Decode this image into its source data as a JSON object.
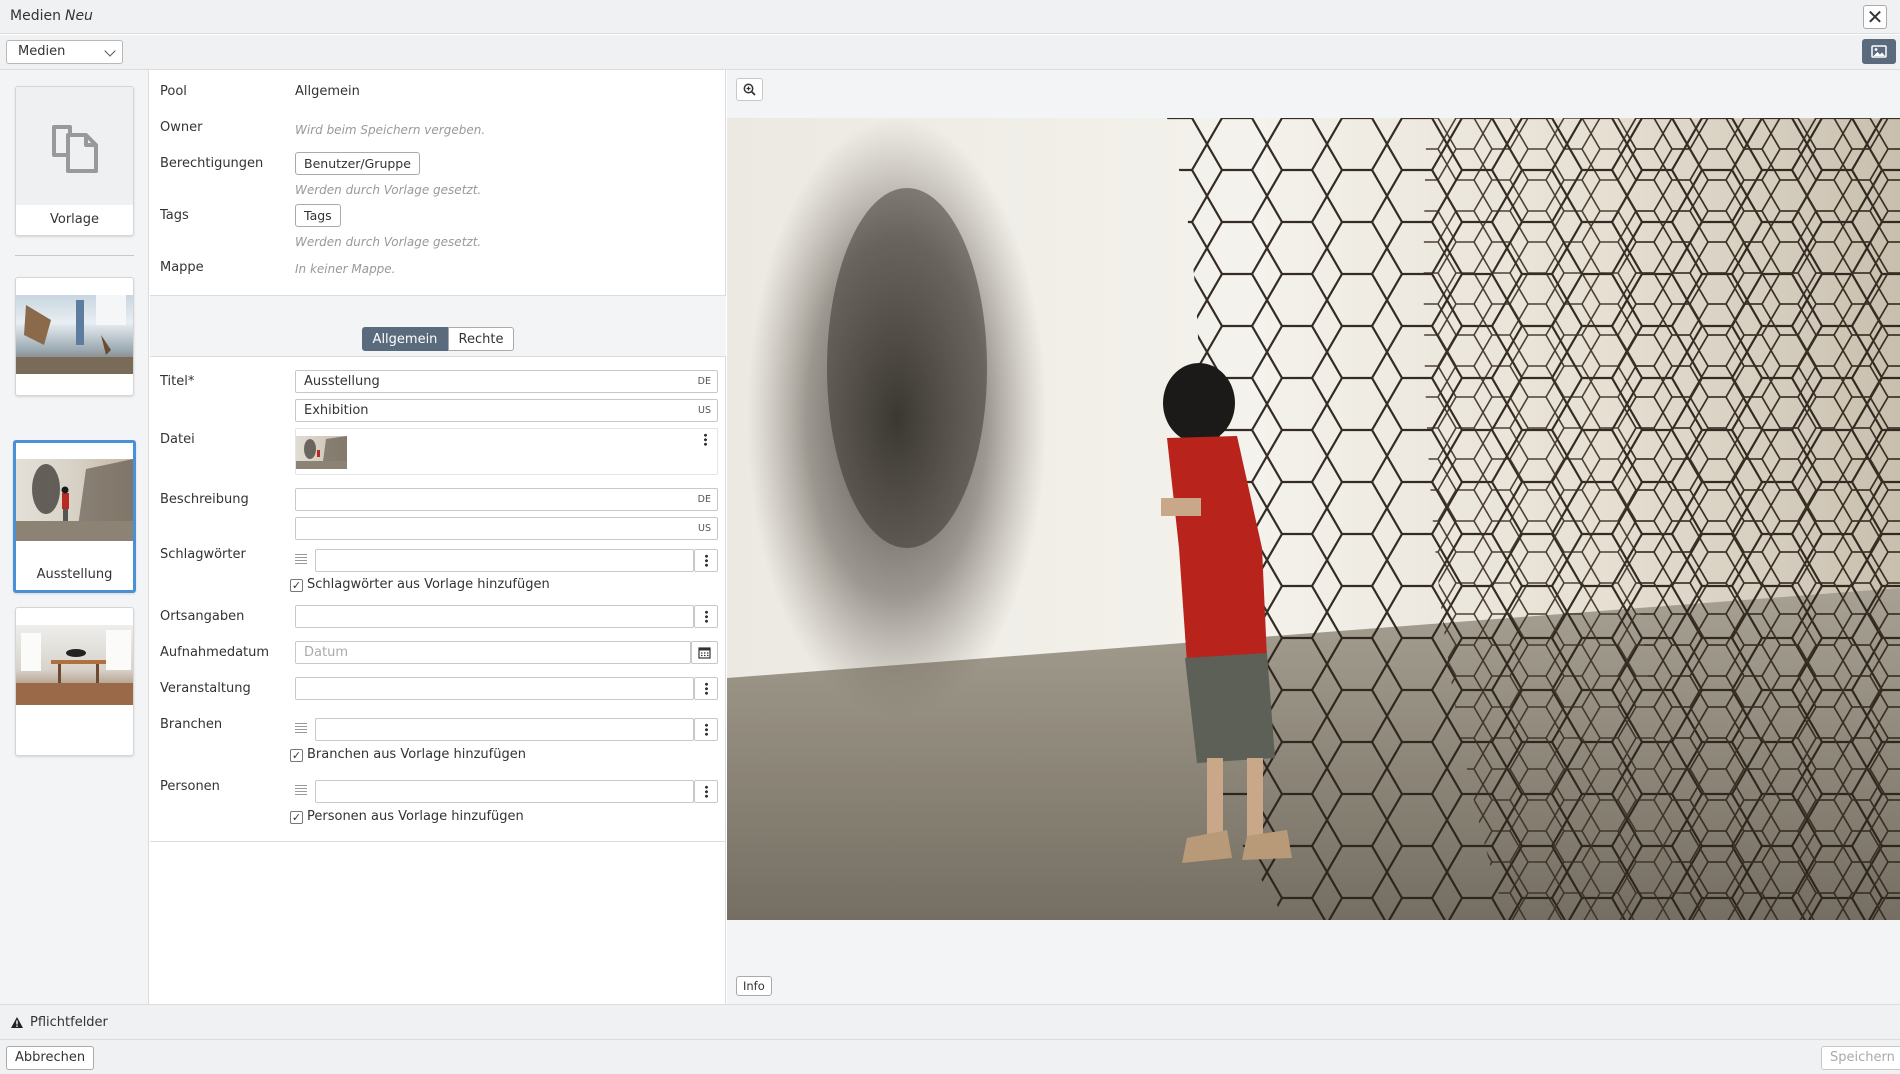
{
  "window": {
    "title": "Medien",
    "title_suffix": "Neu",
    "close_label": "✕"
  },
  "toolbar": {
    "type_select_value": "Medien"
  },
  "sidebar": {
    "template_label": "Vorlage",
    "items": [
      {
        "label": ""
      },
      {
        "label": "Ausstellung",
        "selected": true
      },
      {
        "label": ""
      }
    ]
  },
  "meta": {
    "pool_label": "Pool",
    "pool_value": "Allgemein",
    "owner_label": "Owner",
    "owner_hint": "Wird beim Speichern vergeben.",
    "permissions_label": "Berechtigungen",
    "permissions_button": "Benutzer/Gruppe",
    "permissions_hint": "Werden durch Vorlage gesetzt.",
    "tags_label": "Tags",
    "tags_button": "Tags",
    "tags_hint": "Werden durch Vorlage gesetzt.",
    "folder_label": "Mappe",
    "folder_hint": "In keiner Mappe."
  },
  "tabs": [
    {
      "label": "Allgemein",
      "active": true
    },
    {
      "label": "Rechte",
      "active": false
    }
  ],
  "fields": {
    "title_label": "Titel*",
    "title_de": "Ausstellung",
    "title_de_lang": "DE",
    "title_us": "Exhibition",
    "title_us_lang": "US",
    "file_label": "Datei",
    "description_label": "Beschreibung",
    "description_de_lang": "DE",
    "description_us_lang": "US",
    "keywords_label": "Schlagwörter",
    "keywords_check": "Schlagwörter aus Vorlage hinzufügen",
    "locations_label": "Ortsangaben",
    "date_label": "Aufnahmedatum",
    "date_placeholder": "Datum",
    "event_label": "Veranstaltung",
    "branches_label": "Branchen",
    "branches_check": "Branchen aus Vorlage hinzufügen",
    "persons_label": "Personen",
    "persons_check": "Personen aus Vorlage hinzufügen"
  },
  "preview": {
    "info_label": "Info"
  },
  "footer": {
    "required_label": "Pflichtfelder",
    "cancel_label": "Abbrechen",
    "save_label": "Speichern"
  },
  "colors": {
    "accent": "#5a6b7d",
    "selection": "#4a90d9",
    "panel_bg": "#f3f4f5"
  }
}
